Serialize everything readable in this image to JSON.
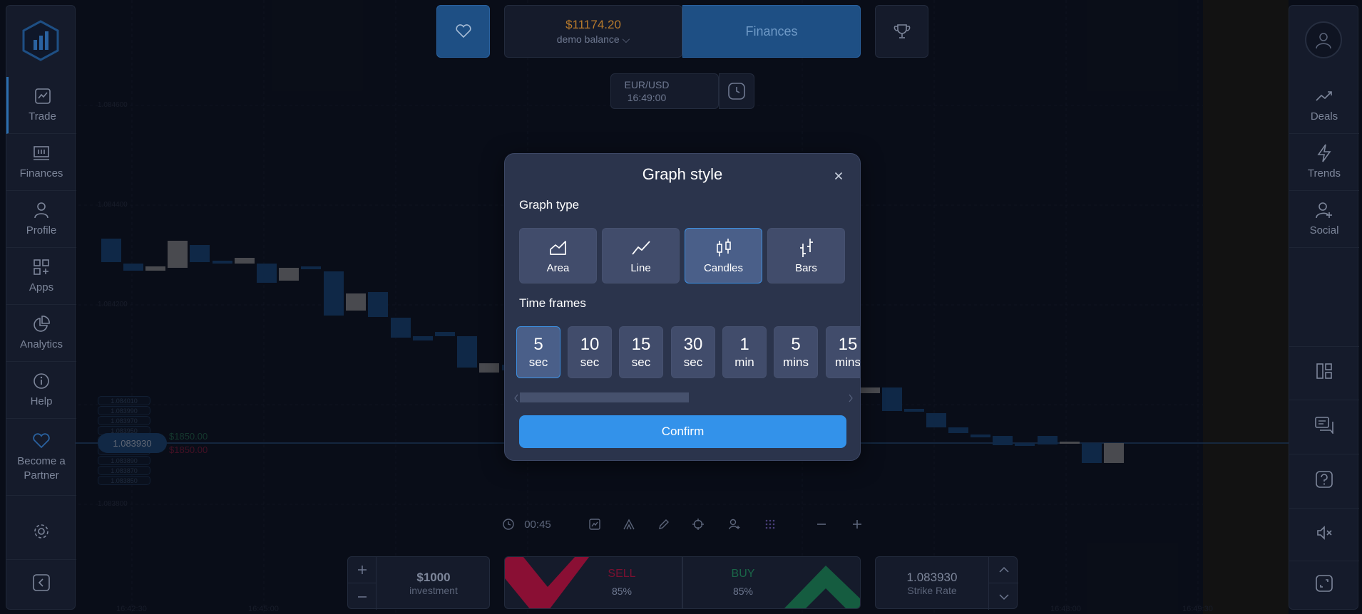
{
  "header": {
    "balance_amount": "$11174.20",
    "balance_label": "demo balance ⌵",
    "finances_label": "Finances"
  },
  "pair": {
    "symbol": "EUR/USD",
    "time": "16:49:00"
  },
  "sidebar_left": {
    "items": [
      {
        "label": "Trade",
        "icon": "chart-icon"
      },
      {
        "label": "Finances",
        "icon": "finances-icon"
      },
      {
        "label": "Profile",
        "icon": "profile-icon"
      },
      {
        "label": "Apps",
        "icon": "apps-icon"
      },
      {
        "label": "Analytics",
        "icon": "analytics-icon"
      },
      {
        "label": "Help",
        "icon": "info-icon"
      },
      {
        "label": "Become a Partner",
        "icon": "heart-icon"
      }
    ]
  },
  "sidebar_right": {
    "items": [
      {
        "label": "Deals"
      },
      {
        "label": "Trends"
      },
      {
        "label": "Social"
      }
    ]
  },
  "chart": {
    "price_levels": [
      "1.084600",
      "1.084400",
      "1.084200",
      "1.083800"
    ],
    "current_price": "1.083930",
    "ladder": [
      "1.084010",
      "1.083990",
      "1.083970",
      "1.083950",
      "1.083930",
      "1.083910",
      "1.083890",
      "1.083870",
      "1.083850"
    ],
    "up_payout": "$1850.00",
    "down_payout": "$1850.00",
    "times": [
      "16:42:30",
      "16:45:00",
      "16:48:00",
      "16:49:30"
    ]
  },
  "toolbar": {
    "timer": "00:45"
  },
  "investment": {
    "amount": "$1000",
    "label": "investment"
  },
  "sell": {
    "label": "SELL",
    "percent": "85%"
  },
  "buy": {
    "label": "BUY",
    "percent": "85%"
  },
  "strike": {
    "value": "1.083930",
    "label": "Strike Rate"
  },
  "modal": {
    "title": "Graph style",
    "graph_type_label": "Graph type",
    "graph_types": [
      {
        "label": "Area",
        "icon": "area-chart-icon"
      },
      {
        "label": "Line",
        "icon": "line-chart-icon"
      },
      {
        "label": "Candles",
        "icon": "candles-icon",
        "selected": true
      },
      {
        "label": "Bars",
        "icon": "bars-icon"
      }
    ],
    "time_frames_label": "Time frames",
    "time_frames": [
      {
        "n": "5",
        "u": "sec",
        "selected": true
      },
      {
        "n": "10",
        "u": "sec"
      },
      {
        "n": "15",
        "u": "sec"
      },
      {
        "n": "30",
        "u": "sec"
      },
      {
        "n": "1",
        "u": "min"
      },
      {
        "n": "5",
        "u": "mins"
      },
      {
        "n": "15",
        "u": "mins"
      }
    ],
    "confirm_label": "Confirm"
  },
  "colors": {
    "accent": "#3392ea",
    "sell": "#b0123f",
    "buy": "#1f7a55",
    "balance": "#b77a2c"
  }
}
